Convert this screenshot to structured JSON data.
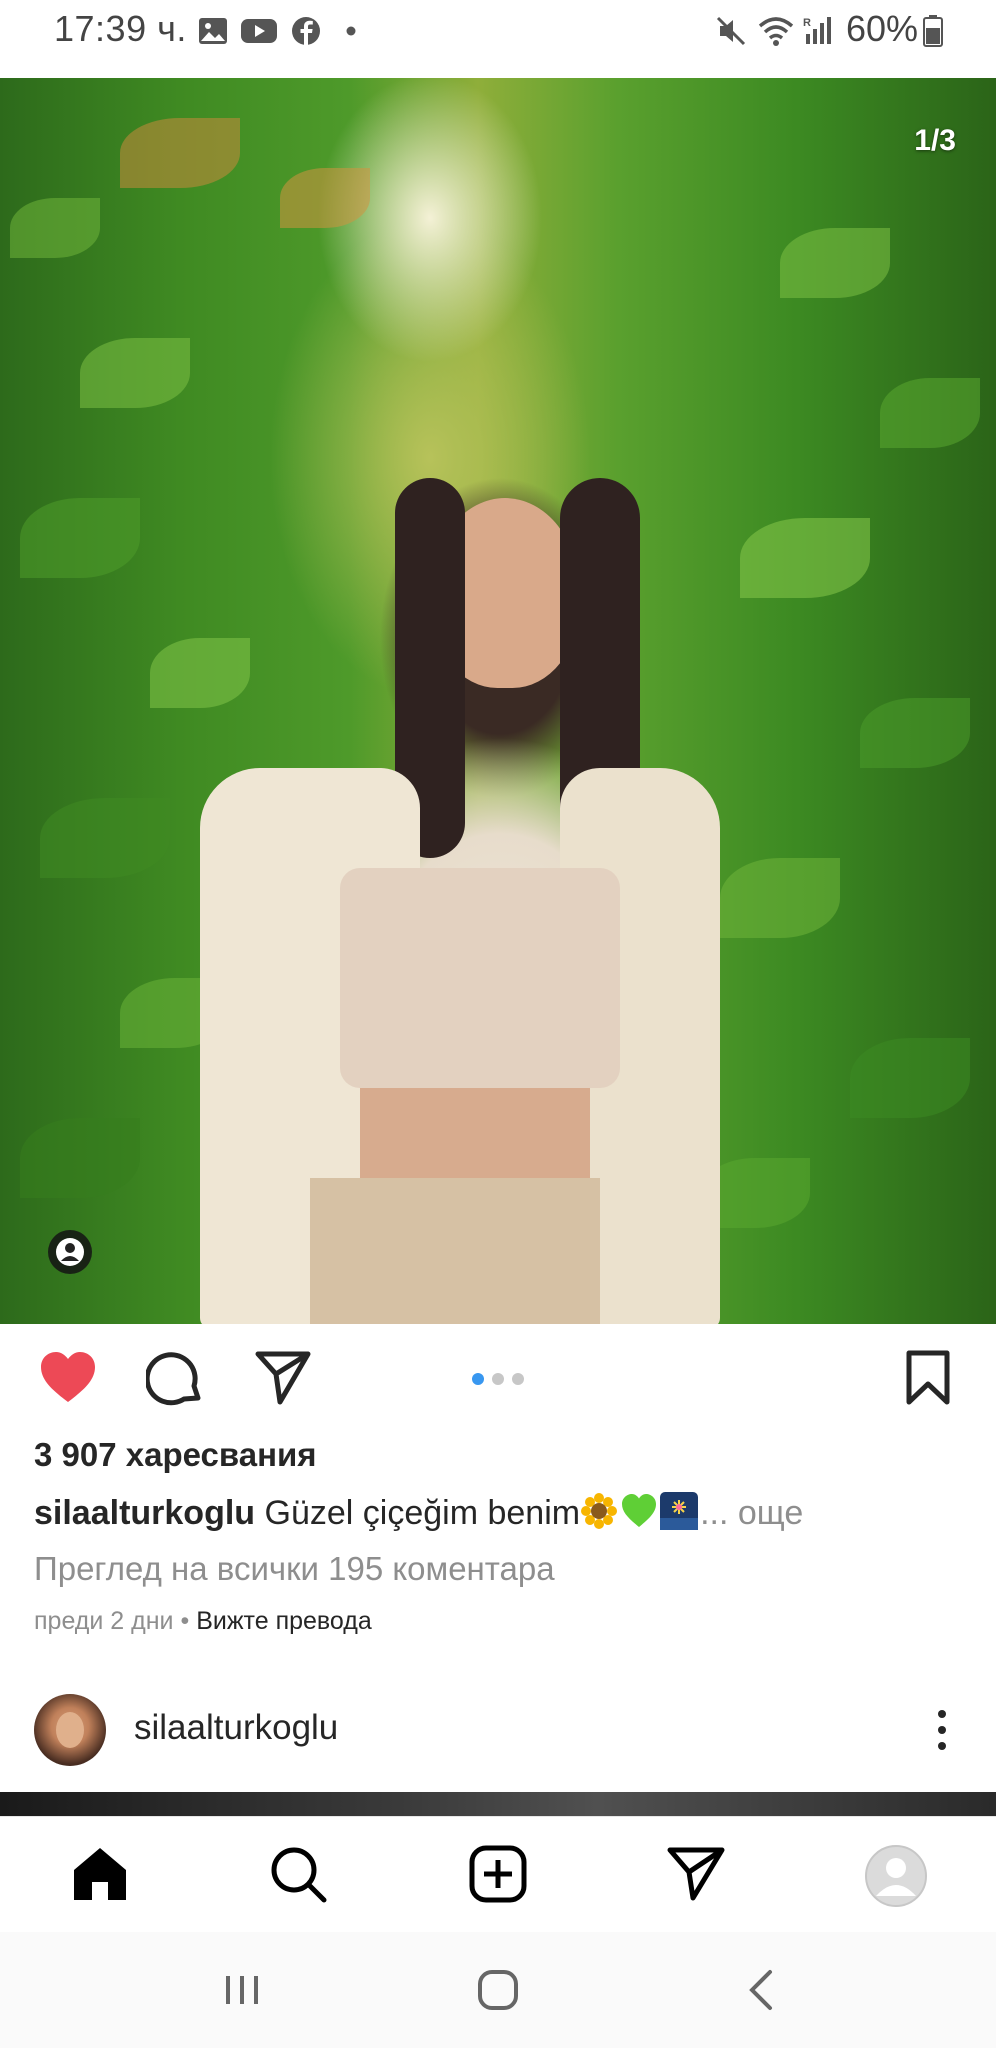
{
  "status_bar": {
    "time": "17:39 ч.",
    "battery": "60%",
    "icons": [
      "gallery-icon",
      "youtube-icon",
      "facebook-icon",
      "dot-icon",
      "mute-icon",
      "wifi-icon",
      "signal-icon",
      "battery-icon"
    ]
  },
  "post": {
    "image_counter": "1/3",
    "likes": "3 907 харесвания",
    "username": "silaalturkoglu",
    "caption_text": "Güzel çiçeğim benim",
    "caption_emojis": [
      "sunflower-emoji",
      "green-heart-emoji",
      "sparkler-emoji"
    ],
    "caption_more": "... още",
    "view_comments": "Преглед на всички 195 коментара",
    "time_ago": "преди 2 дни",
    "separator": "•",
    "translate": "Вижте превода",
    "liked": true,
    "carousel": {
      "count": 3,
      "active_index": 0,
      "active_color": "#3897f0",
      "inactive_color": "#c7c7c7"
    }
  },
  "next_post": {
    "username": "silaalturkoglu"
  },
  "colors": {
    "like_red": "#ed4956",
    "text": "#262626",
    "muted": "#8e8e8e"
  },
  "bottom_nav": [
    "home-icon",
    "search-icon",
    "create-icon",
    "direct-icon",
    "profile-icon"
  ],
  "system_nav": [
    "recents-icon",
    "home-button-icon",
    "back-icon"
  ]
}
